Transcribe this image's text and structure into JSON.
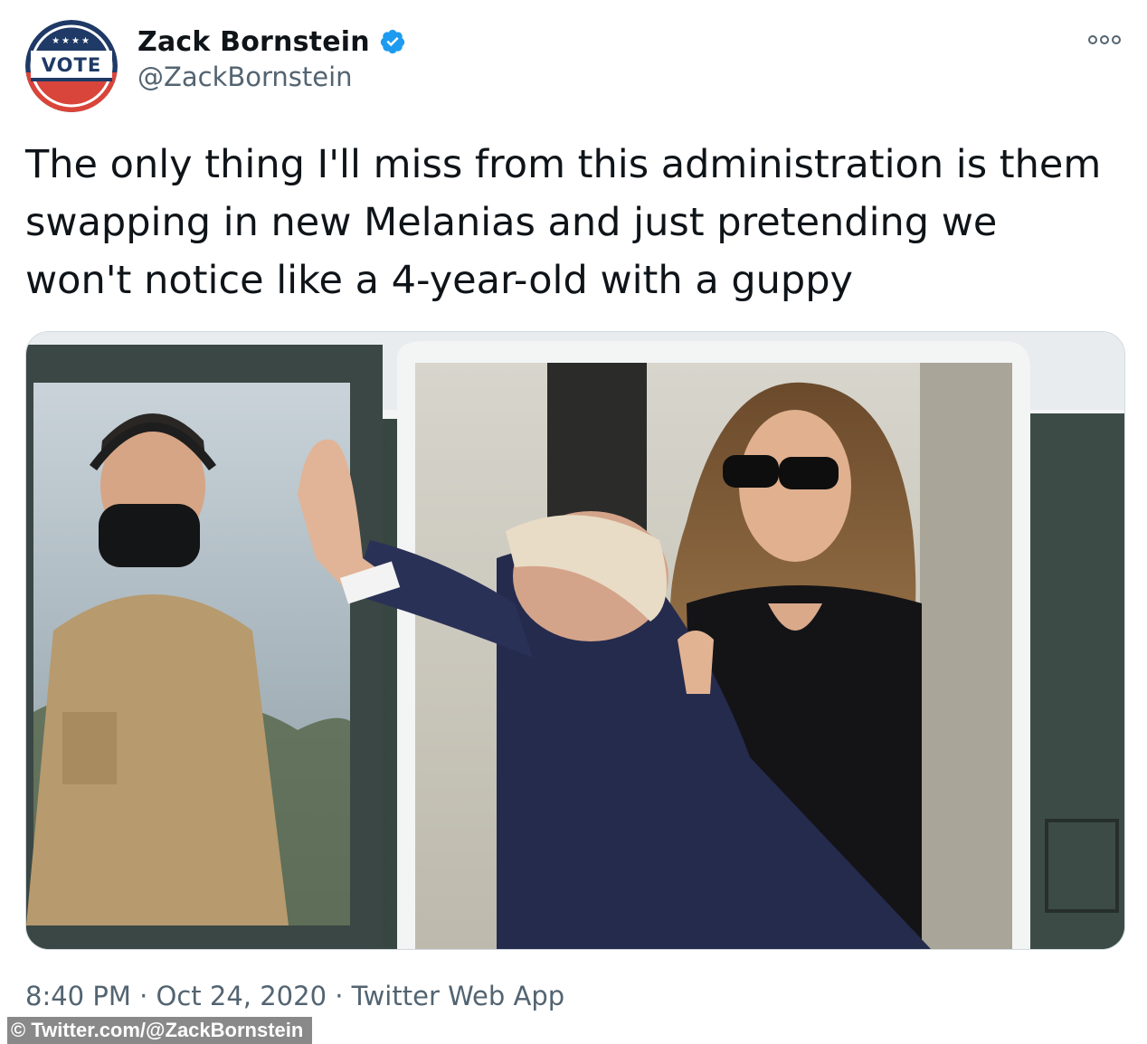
{
  "author": {
    "display_name": "Zack Bornstein",
    "handle": "@ZackBornstein",
    "verified": true,
    "avatar_text": "VOTE",
    "avatar_stars": "★★★★"
  },
  "tweet": {
    "text_lines": [
      "The only thing I'll miss from this administration is them",
      "swapping in new Melanias and just pretending we",
      "won't notice like a 4-year-old with a guppy"
    ],
    "time": "8:40 PM",
    "separator": "·",
    "date": "Oct 24, 2020",
    "source": "Twitter Web App"
  },
  "media": {
    "kind": "photo",
    "subject": "photo"
  },
  "watermark": {
    "text": "© Twitter.com/@ZackBornstein"
  },
  "icons": {
    "more": "more-options-icon",
    "verified": "verified-badge-icon"
  },
  "colors": {
    "verified_blue": "#1d9bf0",
    "secondary_text": "#536471",
    "primary_text": "#0f1419",
    "vote_navy": "#1f3a66",
    "vote_red": "#d9453a"
  }
}
